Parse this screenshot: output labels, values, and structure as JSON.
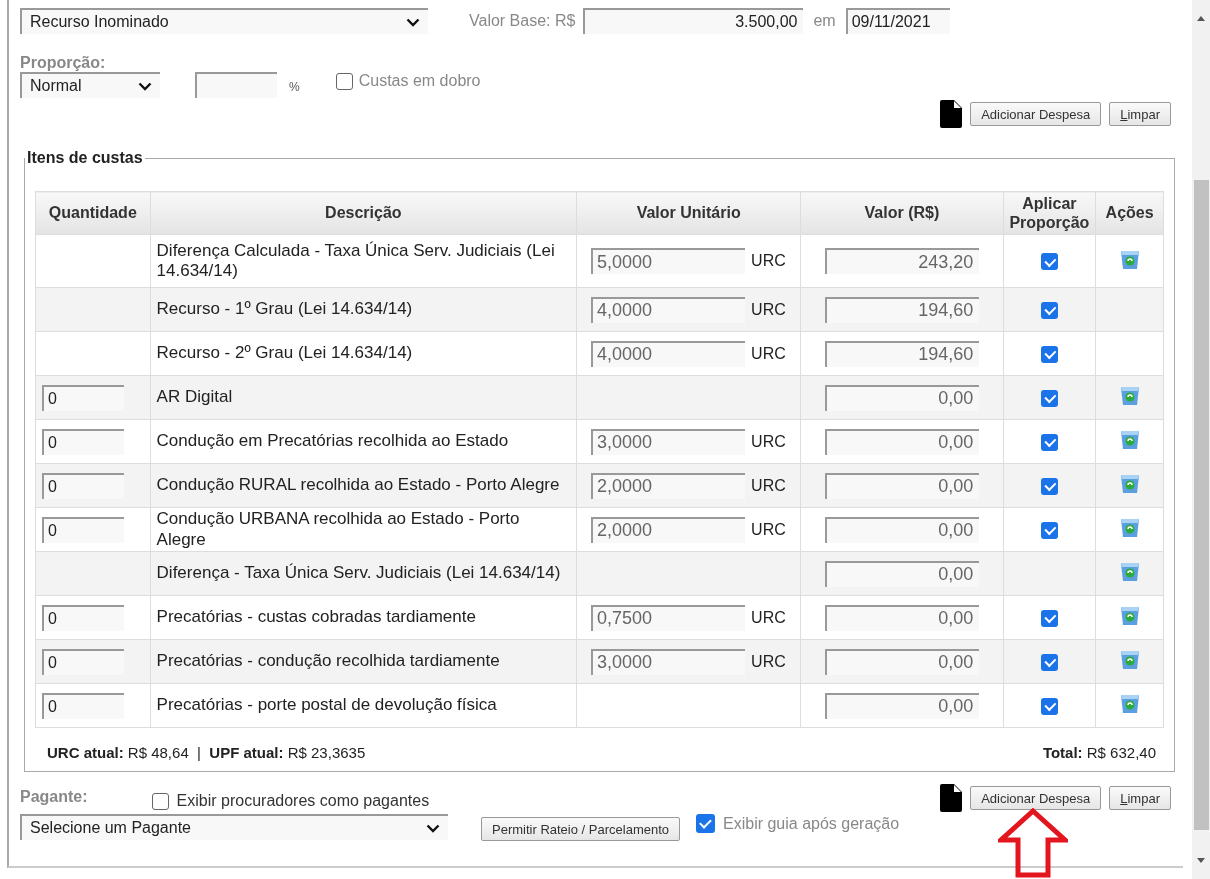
{
  "top_form": {
    "type_select": "Recurso Inominado",
    "base_value_label": "Valor Base: R$",
    "base_value": "3.500,00",
    "date_label": "em",
    "date": "09/11/2021",
    "proportion_label": "Proporção:",
    "proportion_select": "Normal",
    "percent_unit": "%",
    "double_costs": {
      "label": "Custas em dobro",
      "checked": false
    },
    "buttons": [
      "Adicionar Despesa",
      "Limpar"
    ]
  },
  "items": {
    "legend": "Itens de custas",
    "columns": [
      "Quantidade",
      "Descrição",
      "Valor Unitário",
      "Valor (R$)",
      "Aplicar Proporção",
      "Ações"
    ],
    "rows": [
      {
        "description": "Diferença Calculada - Taxa Única Serv. Judiciais (Lei 14.634/14)",
        "unit_value": "5,0000",
        "unit": "URC",
        "value": "243,20",
        "apply_proportion": true,
        "deletable": true
      },
      {
        "description": "Recurso - 1º Grau (Lei 14.634/14)",
        "unit_value": "4,0000",
        "unit": "URC",
        "value": "194,60",
        "apply_proportion": true,
        "deletable": false
      },
      {
        "description": "Recurso - 2º Grau (Lei 14.634/14)",
        "unit_value": "4,0000",
        "unit": "URC",
        "value": "194,60",
        "apply_proportion": true,
        "deletable": false
      },
      {
        "quantity": "0",
        "description": "AR Digital",
        "value": "0,00",
        "apply_proportion": true,
        "deletable": true
      },
      {
        "quantity": "0",
        "description": "Condução em Precatórias recolhida ao Estado",
        "unit_value": "3,0000",
        "unit": "URC",
        "value": "0,00",
        "apply_proportion": true,
        "deletable": true
      },
      {
        "quantity": "0",
        "description": "Condução RURAL recolhida ao Estado - Porto Alegre",
        "unit_value": "2,0000",
        "unit": "URC",
        "value": "0,00",
        "apply_proportion": true,
        "deletable": true
      },
      {
        "quantity": "0",
        "description": "Condução URBANA recolhida ao Estado - Porto Alegre",
        "unit_value": "2,0000",
        "unit": "URC",
        "value": "0,00",
        "apply_proportion": true,
        "deletable": true
      },
      {
        "description": "Diferença - Taxa Única Serv. Judiciais (Lei 14.634/14)",
        "value": "0,00",
        "deletable": true
      },
      {
        "quantity": "0",
        "description": "Precatórias - custas cobradas tardiamente",
        "unit_value": "0,7500",
        "unit": "URC",
        "value": "0,00",
        "apply_proportion": true,
        "deletable": true
      },
      {
        "quantity": "0",
        "description": "Precatórias - condução recolhida tardiamente",
        "unit_value": "3,0000",
        "unit": "URC",
        "value": "0,00",
        "apply_proportion": true,
        "deletable": true
      },
      {
        "quantity": "0",
        "description": "Precatórias - porte postal de devolução física",
        "value": "0,00",
        "apply_proportion": true,
        "deletable": true
      }
    ],
    "urc_label": "URC atual:",
    "urc_value": "R$ 48,64",
    "separator": "|",
    "upf_label": "UPF atual:",
    "upf_value": "R$ 23,3635",
    "total_label": "Total:",
    "total_value": "R$ 632,40"
  },
  "payer": {
    "label": "Pagante:",
    "show_attorneys": {
      "label": "Exibir procuradores como pagantes",
      "checked": false
    },
    "select": "Selecione um Pagante",
    "split_button": "Permitir Rateio / Parcelamento",
    "show_guide": {
      "label": "Exibir guia após geração",
      "checked": true
    },
    "buttons": [
      "Adicionar Despesa",
      "Limpar"
    ]
  }
}
